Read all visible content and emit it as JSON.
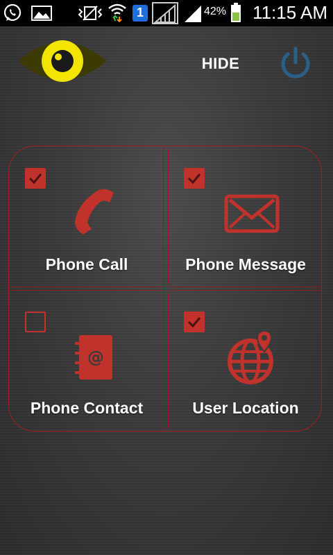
{
  "status_bar": {
    "battery": "42%",
    "time": "11:15 AM",
    "sim_number": "1",
    "icons": [
      "whatsapp-icon",
      "image-icon",
      "vibrate-icon",
      "wifi-icon",
      "sim-icon",
      "no-signal-icon",
      "signal-icon",
      "battery-icon"
    ]
  },
  "header": {
    "logo_icon": "eye-icon",
    "hide_label": "HIDE",
    "power_icon": "power-icon"
  },
  "colors": {
    "accent_red": "#c0322b",
    "eye_yellow": "#f2e600",
    "power_blue": "#2b5f86"
  },
  "options": [
    {
      "label": "Phone Call",
      "checked": true,
      "icon": "phone-icon"
    },
    {
      "label": "Phone Message",
      "checked": true,
      "icon": "envelope-icon"
    },
    {
      "label": "Phone Contact",
      "checked": false,
      "icon": "address-book-icon"
    },
    {
      "label": "User Location",
      "checked": true,
      "icon": "globe-location-icon"
    }
  ]
}
